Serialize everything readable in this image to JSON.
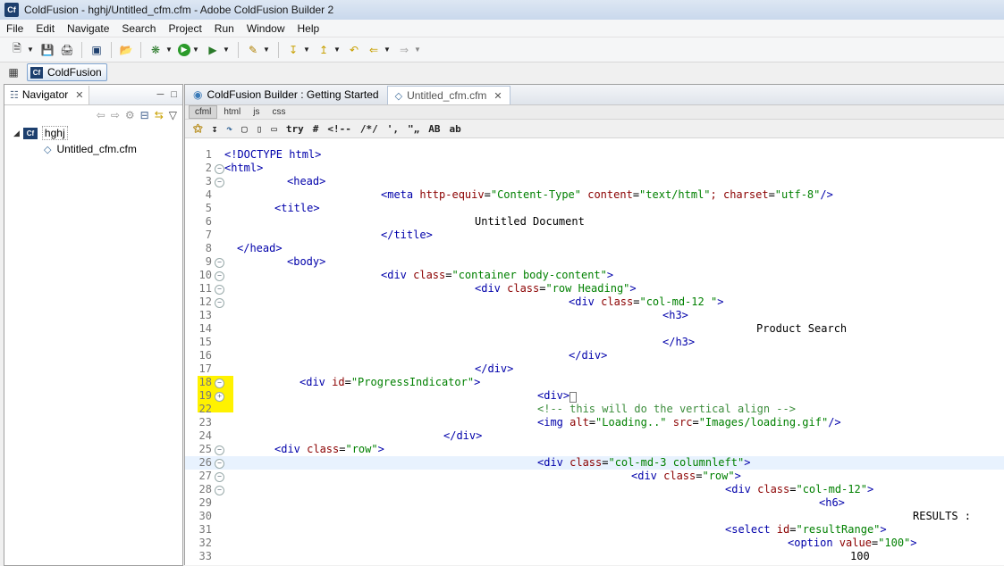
{
  "window": {
    "title": "ColdFusion - hghj/Untitled_cfm.cfm - Adobe ColdFusion Builder 2",
    "app_icon": "Cf"
  },
  "menu": [
    "File",
    "Edit",
    "Navigate",
    "Search",
    "Project",
    "Run",
    "Window",
    "Help"
  ],
  "perspective": {
    "label": "ColdFusion"
  },
  "navigator": {
    "tab_label": "Navigator",
    "project": "hghj",
    "file": "Untitled_cfm.cfm"
  },
  "editor": {
    "tabs": [
      {
        "label": "ColdFusion Builder : Getting Started",
        "icon": "globe-icon"
      },
      {
        "label": "Untitled_cfm.cfm",
        "icon": "cfm-file-icon"
      }
    ],
    "lang_tabs": [
      "cfml",
      "html",
      "js",
      "css"
    ],
    "snippet_buttons": [
      "try",
      "#",
      "<!--",
      "/*/",
      "'‚",
      "\"„",
      "AB",
      "ab"
    ],
    "lines": [
      {
        "n": "1",
        "fold": "",
        "indent": 0,
        "html": "<span class='t'>&lt;!DOCTYPE html&gt;</span>"
      },
      {
        "n": "2",
        "fold": "-",
        "indent": 0,
        "html": "<span class='t'>&lt;html&gt;</span>"
      },
      {
        "n": "3",
        "fold": "-",
        "indent": 70,
        "html": "<span class='t'>&lt;head&gt;</span>"
      },
      {
        "n": "4",
        "fold": "",
        "indent": 175,
        "html": "<span class='t'>&lt;meta </span><span class='a'>http-equiv</span>=<span class='v'>\"Content-Type\"</span> <span class='a'>content</span>=<span class='v'>\"text/html\"</span><span class='a'>; charset</span>=<span class='v'>\"utf-8\"</span><span class='t'>/&gt;</span>"
      },
      {
        "n": "5",
        "fold": "",
        "indent": 56,
        "html": "<span class='t'>&lt;title&gt;</span>"
      },
      {
        "n": "6",
        "fold": "",
        "indent": 280,
        "html": "<span class='p'>Untitled Document</span>"
      },
      {
        "n": "7",
        "fold": "",
        "indent": 175,
        "html": "<span class='t'>&lt;/title&gt;</span>"
      },
      {
        "n": "8",
        "fold": "",
        "indent": 14,
        "html": "<span class='t'>&lt;/head&gt;</span>"
      },
      {
        "n": "9",
        "fold": "-",
        "indent": 70,
        "html": "<span class='t'>&lt;body&gt;</span>"
      },
      {
        "n": "10",
        "fold": "-",
        "indent": 175,
        "html": "<span class='t'>&lt;div </span><span class='a'>class</span>=<span class='v'>\"container body-content\"</span><span class='t'>&gt;</span>"
      },
      {
        "n": "11",
        "fold": "-",
        "indent": 280,
        "html": "<span class='t'>&lt;div </span><span class='a'>class</span>=<span class='v'>\"row Heading\"</span><span class='t'>&gt;</span>"
      },
      {
        "n": "12",
        "fold": "-",
        "indent": 385,
        "html": "<span class='t'>&lt;div </span><span class='a'>class</span>=<span class='v'>\"col-md-12 \"</span><span class='t'>&gt;</span>"
      },
      {
        "n": "13",
        "fold": "",
        "indent": 490,
        "html": "<span class='t'>&lt;h3&gt;</span>"
      },
      {
        "n": "14",
        "fold": "",
        "indent": 595,
        "html": "<span class='p'>Product Search</span>"
      },
      {
        "n": "15",
        "fold": "",
        "indent": 490,
        "html": "<span class='t'>&lt;/h3&gt;</span>"
      },
      {
        "n": "16",
        "fold": "",
        "indent": 385,
        "html": "<span class='t'>&lt;/div&gt;</span>"
      },
      {
        "n": "17",
        "fold": "",
        "indent": 280,
        "html": "<span class='t'>&lt;/div&gt;</span>"
      },
      {
        "n": "18",
        "fold": "-",
        "indent": 84,
        "html": "<span class='t'>&lt;div </span><span class='a'>id</span>=<span class='v'>\"ProgressIndicator\"</span><span class='t'>&gt;</span>"
      },
      {
        "n": "19",
        "fold": "+",
        "indent": 350,
        "html": "<span class='t'>&lt;div&gt;</span><span style='border:1px solid #777;font-size:9px'>&nbsp;</span>"
      },
      {
        "n": "22",
        "fold": "",
        "indent": 350,
        "html": "<span class='c'>&lt;!-- this will do the vertical align --&gt;</span>"
      },
      {
        "n": "23",
        "fold": "",
        "indent": 350,
        "html": "<span class='t'>&lt;img </span><span class='a'>alt</span>=<span class='v'>\"Loading..\"</span> <span class='a'>src</span>=<span class='v'>\"Images/loading.gif\"</span><span class='t'>/&gt;</span>"
      },
      {
        "n": "24",
        "fold": "",
        "indent": 245,
        "html": "<span class='t'>&lt;/div&gt;</span>"
      },
      {
        "n": "25",
        "fold": "-",
        "indent": 56,
        "html": "<span class='t'>&lt;div </span><span class='a'>class</span>=<span class='v'>\"row\"</span><span class='t'>&gt;</span>"
      },
      {
        "n": "26",
        "fold": "-",
        "indent": 350,
        "html": "<span class='t'>&lt;div </span><span class='a'>class</span>=<span class='v'>\"col-md-3 columnleft\"</span><span class='t'>&gt;</span>",
        "current": true
      },
      {
        "n": "27",
        "fold": "-",
        "indent": 455,
        "html": "<span class='t'>&lt;div </span><span class='a'>class</span>=<span class='v'>\"row\"</span><span class='t'>&gt;</span>"
      },
      {
        "n": "28",
        "fold": "-",
        "indent": 560,
        "html": "<span class='t'>&lt;div </span><span class='a'>class</span>=<span class='v'>\"col-md-12\"</span><span class='t'>&gt;</span>"
      },
      {
        "n": "29",
        "fold": "",
        "indent": 665,
        "html": "<span class='t'>&lt;h6&gt;</span>"
      },
      {
        "n": "30",
        "fold": "",
        "indent": 770,
        "html": "<span class='p'>RESULTS :</span>"
      },
      {
        "n": "31",
        "fold": "",
        "indent": 560,
        "html": "<span class='t'>&lt;select </span><span class='a'>id</span>=<span class='v'>\"resultRange\"</span><span class='t'>&gt;</span>"
      },
      {
        "n": "32",
        "fold": "",
        "indent": 630,
        "html": "<span class='t'>&lt;option </span><span class='a'>value</span>=<span class='v'>\"100\"</span><span class='t'>&gt;</span>"
      },
      {
        "n": "33",
        "fold": "",
        "indent": 700,
        "html": "<span class='p'>100</span>"
      }
    ]
  },
  "colors": {
    "highlight": "#fff200",
    "tag": "#0000aa",
    "attr": "#8b0000",
    "value": "#008000"
  }
}
